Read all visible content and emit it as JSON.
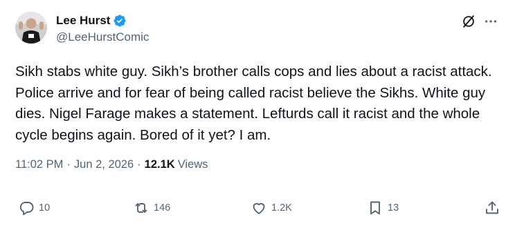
{
  "author": {
    "display_name": "Lee Hurst",
    "handle": "@LeeHurstComic",
    "verified": true
  },
  "tweet": {
    "text": "Sikh stabs white guy. Sikh’s brother calls cops and lies about a racist attack. Police arrive and for fear of being called racist believe the Sikhs. White guy dies. Nigel Farage makes a statement. Lefturds call it racist and the whole cycle begins again. Bored of it yet? I am.",
    "time": "11:02 PM",
    "date": "Jun 2, 2026",
    "views_count": "12.1K",
    "views_label": "Views"
  },
  "actions": {
    "replies": "10",
    "reposts": "146",
    "likes": "1.2K",
    "bookmarks": "13"
  },
  "icons": {
    "verified": "verified-badge-icon",
    "grok": "grok-icon",
    "more": "more-icon",
    "reply": "reply-icon",
    "retweet": "retweet-icon",
    "like": "heart-icon",
    "bookmark": "bookmark-icon",
    "share": "share-icon"
  },
  "colors": {
    "verified": "#1d9bf0",
    "text": "#0f1419",
    "secondary": "#536471"
  }
}
